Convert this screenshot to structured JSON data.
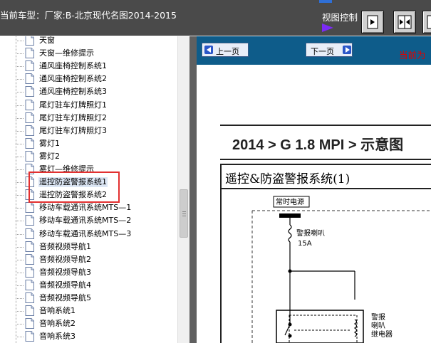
{
  "header": {
    "model_label": "当前车型：厂家:B-北京现代名图2014-2015",
    "view_control_label": "视图控制"
  },
  "tree": {
    "items": [
      {
        "label": "天窗"
      },
      {
        "label": "天窗—维修提示"
      },
      {
        "label": "通风座椅控制系统1"
      },
      {
        "label": "通风座椅控制系统2"
      },
      {
        "label": "通风座椅控制系统3"
      },
      {
        "label": "尾灯驻车灯牌照灯1"
      },
      {
        "label": "尾灯驻车灯牌照灯2"
      },
      {
        "label": "尾灯驻车灯牌照灯3"
      },
      {
        "label": "雾灯1"
      },
      {
        "label": "雾灯2"
      },
      {
        "label": "雾灯—维修提示"
      },
      {
        "label": "遥控防盗警报系统1",
        "selected": true
      },
      {
        "label": "遥控防盗警报系统2"
      },
      {
        "label": "移动车载通讯系统MTS—1"
      },
      {
        "label": "移动车载通讯系统MTS—2"
      },
      {
        "label": "移动车载通讯系统MTS—3"
      },
      {
        "label": "音频视频导航1"
      },
      {
        "label": "音频视频导航2"
      },
      {
        "label": "音频视频导航3"
      },
      {
        "label": "音频视频导航4"
      },
      {
        "label": "音频视频导航5"
      },
      {
        "label": "音响系统1"
      },
      {
        "label": "音响系统2"
      },
      {
        "label": "音响系统3"
      }
    ]
  },
  "nav": {
    "prev_label": "上一页",
    "next_label": "下一页",
    "current_label": "当前为"
  },
  "content": {
    "breadcrumb": "2014 > G 1.8 MPI > 示意图",
    "diagram_title": "遥控&防盗警报系统(1)",
    "schematic": {
      "power_label": "常时电源",
      "horn_fuse_label": "警报喇叭",
      "fuse_rating": "15A",
      "relay_label_1": "警报",
      "relay_label_2": "喇叭",
      "relay_label_3": "继电器"
    }
  },
  "colors": {
    "header_bg": "#4a4a4a",
    "nav_bar_bg": "#0e5c8a",
    "highlight_box": "#e23030",
    "current_label": "#e00000",
    "view_arrow": "#7b2bf5"
  }
}
